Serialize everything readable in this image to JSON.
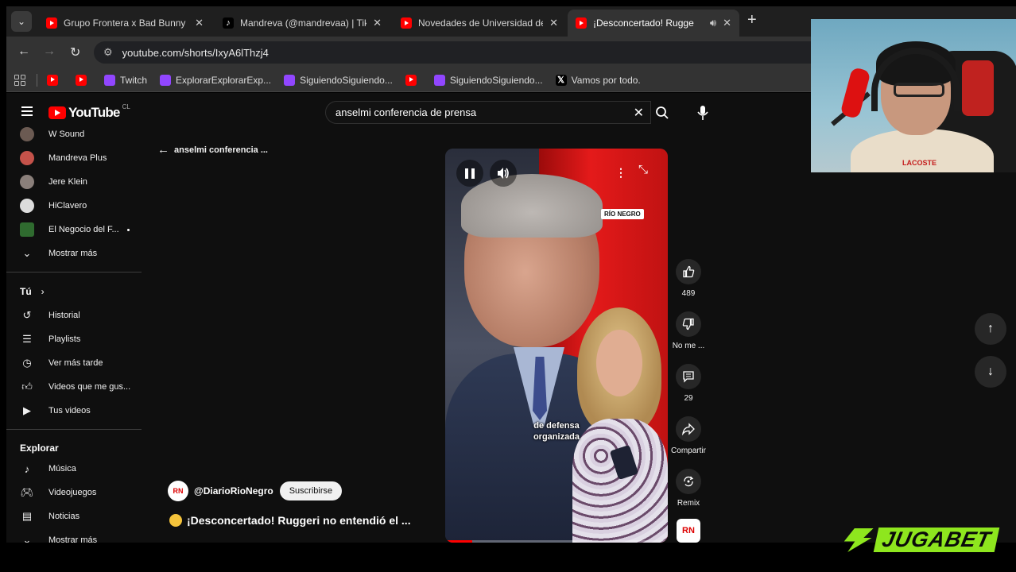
{
  "browser": {
    "tabs": [
      {
        "label": "Grupo Frontera x Bad Bunny - L",
        "icon": "youtube-icon"
      },
      {
        "label": "Mandreva (@mandrevaa) | TikTo",
        "icon": "tiktok-icon"
      },
      {
        "label": "Novedades de Universidad de C",
        "icon": "youtube-icon"
      },
      {
        "label": "¡Desconcertado! Rugge",
        "icon": "youtube-icon",
        "active": true
      }
    ],
    "url": "youtube.com/shorts/IxyA6lThzj4",
    "bookmarks": [
      {
        "label": "",
        "icon": "youtube-icon"
      },
      {
        "label": "",
        "icon": "youtube-icon"
      },
      {
        "label": "Twitch",
        "icon": "twitch-icon"
      },
      {
        "label": "ExplorarExplorarExp...",
        "icon": "twitch-icon"
      },
      {
        "label": "SiguiendoSiguiendo...",
        "icon": "twitch-icon"
      },
      {
        "label": "",
        "icon": "youtube-icon"
      },
      {
        "label": "SiguiendoSiguiendo...",
        "icon": "twitch-icon"
      },
      {
        "label": "Vamos por todo.",
        "icon": "x-icon"
      }
    ]
  },
  "youtube": {
    "logo_text": "YouTube",
    "country": "CL",
    "search_query": "anselmi conferencia de prensa",
    "subscriptions": [
      {
        "label": "W Sound",
        "avatar_color": "#6b5a52"
      },
      {
        "label": "Mandreva Plus",
        "avatar_color": "#c4524a"
      },
      {
        "label": "Jere Klein",
        "avatar_color": "#8a7f7a"
      },
      {
        "label": "HiClavero",
        "avatar_color": "#dcdcdc"
      },
      {
        "label": "El Negocio del F...",
        "avatar_color": "#2f6b2f"
      }
    ],
    "show_more_label": "Mostrar más",
    "you_section": {
      "heading": "Tú",
      "items": [
        {
          "label": "Historial",
          "icon": "history-icon"
        },
        {
          "label": "Playlists",
          "icon": "playlist-icon"
        },
        {
          "label": "Ver más tarde",
          "icon": "clock-icon"
        },
        {
          "label": "Videos que me gus...",
          "icon": "thumbs-up-icon"
        },
        {
          "label": "Tus videos",
          "icon": "video-icon"
        }
      ]
    },
    "explore_section": {
      "heading": "Explorar",
      "items": [
        {
          "label": "Música",
          "icon": "music-icon"
        },
        {
          "label": "Videojuegos",
          "icon": "gamepad-icon"
        },
        {
          "label": "Noticias",
          "icon": "news-icon"
        },
        {
          "label": "Mostrar más",
          "icon": "chevron-down-icon"
        }
      ]
    },
    "back_label": "anselmi conferencia ...",
    "short": {
      "video_tag": "RÍO NEGRO",
      "subtitle": "de defensa organizada",
      "progress": 0.12,
      "channel_handle": "@DiarioRioNegro",
      "channel_badge": "RN",
      "subscribe_label": "Suscribirse",
      "title": "¡Desconcertado! Ruggeri no entendió el ...",
      "likes": "489",
      "dislike_label": "No me ...",
      "comments": "29",
      "share_label": "Compartir",
      "remix_label": "Remix"
    }
  },
  "overlay": {
    "webcam_shirt_text": "LACOSTE",
    "sponsor_left": "JUGA",
    "sponsor_right": "BET"
  }
}
